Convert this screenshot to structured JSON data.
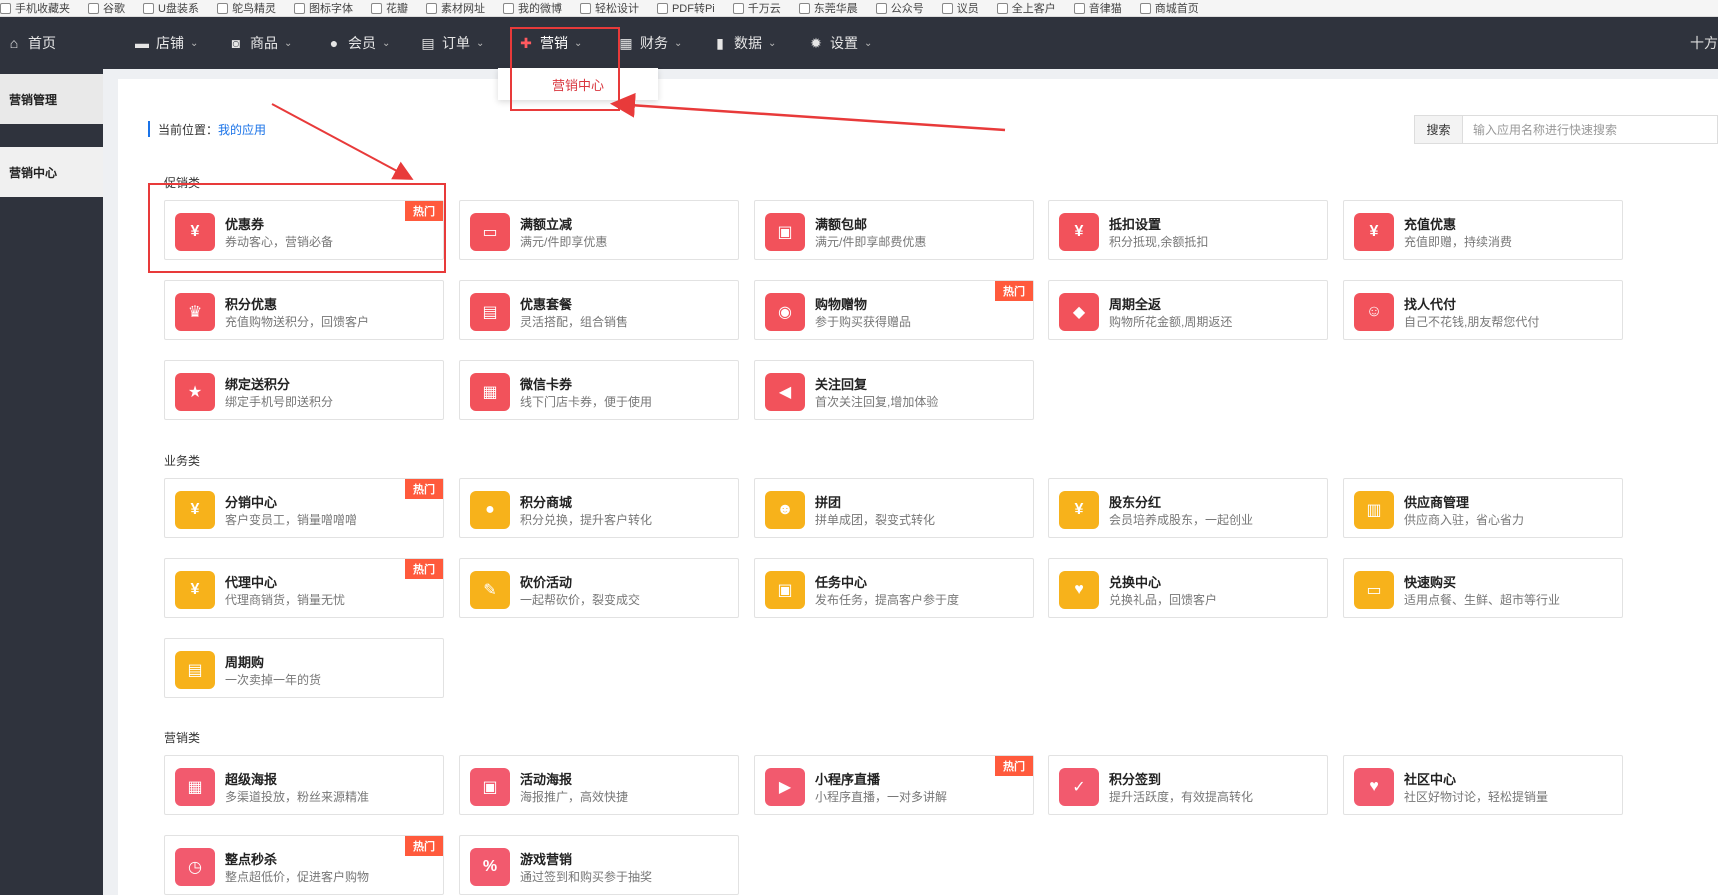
{
  "bookmarks": [
    {
      "label": "手机收藏夹"
    },
    {
      "label": "谷歌"
    },
    {
      "label": "U盘装系"
    },
    {
      "label": "鸵鸟精灵"
    },
    {
      "label": "图标字体"
    },
    {
      "label": "花瓣"
    },
    {
      "label": "素材网址"
    },
    {
      "label": "我的微博"
    },
    {
      "label": "轻松设计"
    },
    {
      "label": "PDF转Pi"
    },
    {
      "label": "千万云"
    },
    {
      "label": "东莞华晨"
    },
    {
      "label": "公众号"
    },
    {
      "label": "议员"
    },
    {
      "label": "全上客户"
    },
    {
      "label": "音律猫"
    },
    {
      "label": "商城首页"
    }
  ],
  "nav": {
    "items": [
      {
        "label": "首页",
        "icon": "home-icon"
      },
      {
        "label": "店铺",
        "icon": "store-icon"
      },
      {
        "label": "商品",
        "icon": "goods-icon"
      },
      {
        "label": "会员",
        "icon": "member-icon"
      },
      {
        "label": "订单",
        "icon": "order-icon"
      },
      {
        "label": "营销",
        "icon": "gift-icon"
      },
      {
        "label": "财务",
        "icon": "finance-icon"
      },
      {
        "label": "数据",
        "icon": "chart-icon"
      },
      {
        "label": "设置",
        "icon": "gear-icon"
      }
    ],
    "right_text": "十方",
    "dropdown_item": "营销中心"
  },
  "sidebar": {
    "items": [
      {
        "label": "营销管理"
      },
      {
        "label": "营销中心"
      }
    ]
  },
  "breadcrumb": {
    "prefix": "当前位置：",
    "link": "我的应用"
  },
  "search": {
    "button": "搜索",
    "placeholder": "输入应用名称进行快速搜索"
  },
  "hot_label": "热门",
  "sections": [
    {
      "title": "促销类",
      "color": "red",
      "cards": [
        {
          "title": "优惠券",
          "desc": "券动客心，营销必备",
          "hot": true,
          "glyph": "¥"
        },
        {
          "title": "满额立减",
          "desc": "满元/件即享优惠",
          "hot": false,
          "glyph": "▭"
        },
        {
          "title": "满额包邮",
          "desc": "满元/件即享邮费优惠",
          "hot": false,
          "glyph": "▣"
        },
        {
          "title": "抵扣设置",
          "desc": "积分抵现,余额抵扣",
          "hot": false,
          "glyph": "¥"
        },
        {
          "title": "充值优惠",
          "desc": "充值即赠，持续消费",
          "hot": false,
          "glyph": "¥"
        },
        {
          "title": "积分优惠",
          "desc": "充值购物送积分，回馈客户",
          "hot": false,
          "glyph": "♛"
        },
        {
          "title": "优惠套餐",
          "desc": "灵活搭配，组合销售",
          "hot": false,
          "glyph": "▤"
        },
        {
          "title": "购物赠物",
          "desc": "参于购买获得赠品",
          "hot": true,
          "glyph": "◉"
        },
        {
          "title": "周期全返",
          "desc": "购物所花金额,周期返还",
          "hot": false,
          "glyph": "◆"
        },
        {
          "title": "找人代付",
          "desc": "自己不花钱,朋友帮您代付",
          "hot": false,
          "glyph": "☺"
        },
        {
          "title": "绑定送积分",
          "desc": "绑定手机号即送积分",
          "hot": false,
          "glyph": "★"
        },
        {
          "title": "微信卡券",
          "desc": "线下门店卡券，便于使用",
          "hot": false,
          "glyph": "▦"
        },
        {
          "title": "关注回复",
          "desc": "首次关注回复,增加体验",
          "hot": false,
          "glyph": "◀"
        }
      ]
    },
    {
      "title": "业务类",
      "color": "yellow",
      "cards": [
        {
          "title": "分销中心",
          "desc": "客户变员工，销量噌噌噌",
          "hot": true,
          "glyph": "¥"
        },
        {
          "title": "积分商城",
          "desc": "积分兑换，提升客户转化",
          "hot": false,
          "glyph": "●"
        },
        {
          "title": "拼团",
          "desc": "拼单成团，裂变式转化",
          "hot": false,
          "glyph": "☻"
        },
        {
          "title": "股东分红",
          "desc": "会员培养成股东，一起创业",
          "hot": false,
          "glyph": "¥"
        },
        {
          "title": "供应商管理",
          "desc": "供应商入驻，省心省力",
          "hot": false,
          "glyph": "▥"
        },
        {
          "title": "代理中心",
          "desc": "代理商销货，销量无忧",
          "hot": true,
          "glyph": "¥"
        },
        {
          "title": "砍价活动",
          "desc": "一起帮砍价，裂变成交",
          "hot": false,
          "glyph": "✎"
        },
        {
          "title": "任务中心",
          "desc": "发布任务，提高客户参于度",
          "hot": false,
          "glyph": "▣"
        },
        {
          "title": "兑换中心",
          "desc": "兑换礼品，回馈客户",
          "hot": false,
          "glyph": "♥"
        },
        {
          "title": "快速购买",
          "desc": "适用点餐、生鲜、超市等行业",
          "hot": false,
          "glyph": "▭"
        },
        {
          "title": "周期购",
          "desc": "一次卖掉一年的货",
          "hot": false,
          "glyph": "▤"
        }
      ]
    },
    {
      "title": "营销类",
      "color": "pink",
      "cards": [
        {
          "title": "超级海报",
          "desc": "多渠道投放，粉丝来源精准",
          "hot": false,
          "glyph": "▦"
        },
        {
          "title": "活动海报",
          "desc": "海报推广，高效快捷",
          "hot": false,
          "glyph": "▣"
        },
        {
          "title": "小程序直播",
          "desc": "小程序直播，一对多讲解",
          "hot": true,
          "glyph": "▶"
        },
        {
          "title": "积分签到",
          "desc": "提升活跃度，有效提高转化",
          "hot": false,
          "glyph": "✓"
        },
        {
          "title": "社区中心",
          "desc": "社区好物讨论，轻松提销量",
          "hot": false,
          "glyph": "♥"
        },
        {
          "title": "整点秒杀",
          "desc": "整点超低价，促进客户购物",
          "hot": true,
          "glyph": "◷"
        },
        {
          "title": "游戏营销",
          "desc": "通过签到和购买参于抽奖",
          "hot": false,
          "glyph": "%"
        }
      ]
    }
  ],
  "annotation_color": "#e83a3a"
}
